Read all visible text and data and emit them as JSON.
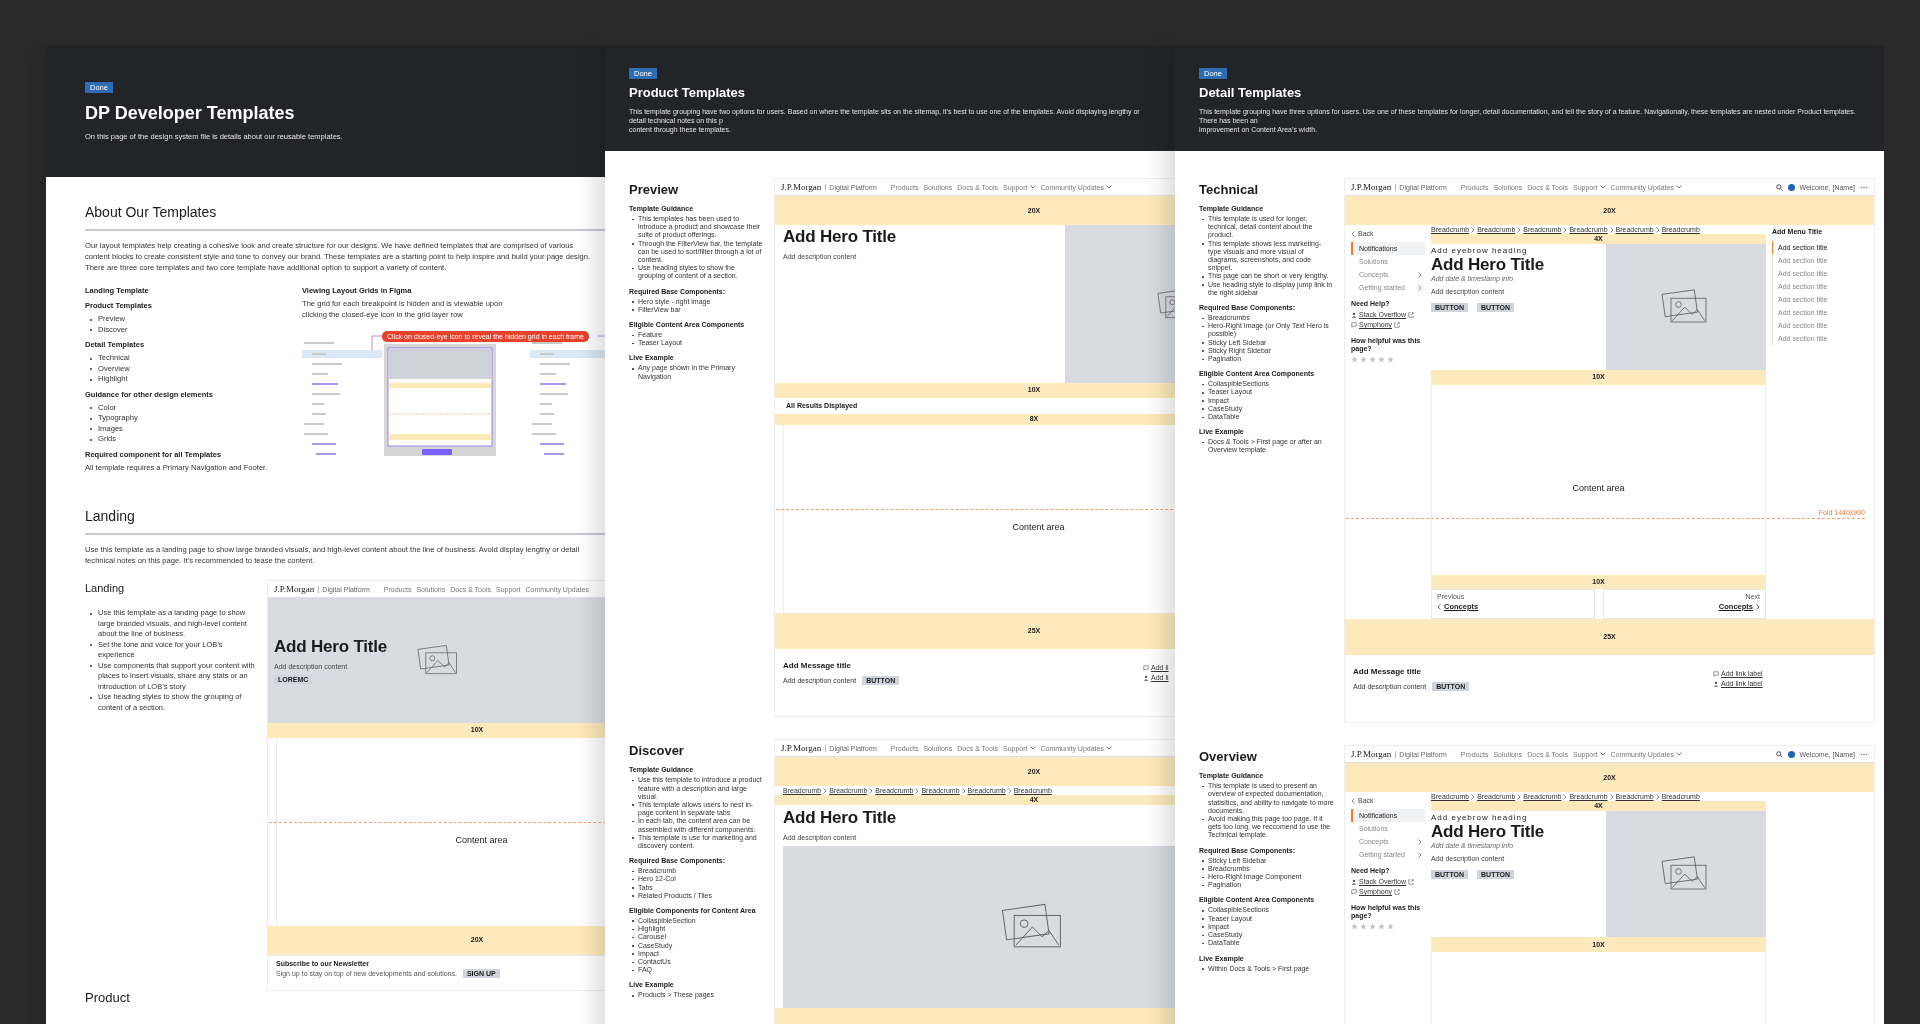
{
  "frames": [
    {
      "kind": "intro",
      "badge": "Done",
      "title": "DP Developer Templates",
      "description_lines": [
        "On this page of the design system file is details about our reusable templates."
      ],
      "about": {
        "heading": "About Our Templates",
        "paragraph": "Our layout templates help creating a cohesive look and create structure for our designs. We have defined templates that are comprised of various content blocks to create consistent style and tone to convey our brand. These templates are a starting point to help inspire and build your page design. There are three core templates and two core template have additional option to support a variety of content.",
        "groups": [
          {
            "heading": "Landing Template"
          },
          {
            "heading": "Product Templates",
            "items": [
              "Preview",
              "Discover"
            ]
          },
          {
            "heading": "Detail Templates",
            "items": [
              "Technical",
              "Overview",
              "Highlight"
            ]
          },
          {
            "heading": "Guidance for other design elements",
            "items": [
              "Color",
              "Typography",
              "Images",
              "Grids"
            ]
          },
          {
            "heading": "Required component for all Templates",
            "text": "All template requires a Primary Navigation and Footer."
          }
        ],
        "tip": {
          "heading": "Viewing Layout Grids in Figma",
          "text": "The grid for each breakpoint is hidden and is viewable upon clicking the closed-eye icon in the grid layer row",
          "callout": "Click on closed-eye icon to reveal the hidden grid in each frame"
        }
      },
      "section": {
        "heading": "Landing",
        "paragraph": "Use this template as a landing page to show large branded visuals, and high-level content about the line of business. Avoid display lengthy or detail technical notes on this page. It’s recommended to tease the content."
      },
      "templates": [
        {
          "name": "Landing",
          "guidance": [
            {
              "items": [
                "Use this template as a landing page to show large branded visuals, and high-level content about the line of business.",
                "Set the tone and voice for your LOB’s experience",
                "Use components that support your content with places to insert visuals, share any stats or an introduction of LOB’s story",
                "Use heading styles to show the grouping of content of a section."
              ]
            }
          ],
          "mockup": {
            "nav": {
              "logo": "J.P.Morgan",
              "product": "Digital Platform",
              "links": [
                {
                  "label": "Products",
                  "dropdown": false
                },
                {
                  "label": "Solutions",
                  "dropdown": false
                },
                {
                  "label": "Docs & Tools",
                  "dropdown": false
                },
                {
                  "label": "Support",
                  "dropdown": false
                },
                {
                  "label": "Community Updates",
                  "dropdown": false
                }
              ]
            },
            "blocks": [
              {
                "kind": "hero-banner",
                "title": "Add Hero Title",
                "description": "Add description content",
                "button": "LOREMC"
              },
              {
                "kind": "spacer",
                "label": "10X"
              },
              {
                "kind": "content",
                "label": "Content area",
                "fold": true
              },
              {
                "kind": "spacer",
                "label": "20X"
              },
              {
                "kind": "newsletter",
                "title": "Subscribe to our Newsletter",
                "text": "Sign up to stay on top of new developments and solutions.",
                "button": "SIGN UP"
              }
            ]
          }
        }
      ],
      "next_heading": "Product"
    },
    {
      "kind": "group",
      "badge": "Done",
      "title": "Product Templates",
      "description_lines": [
        "This template grouping have two options for users. Based on where the template sits on the sitemap, it’s best to use one of the templates. Avoid displaying lengthy or detail technical notes on this p",
        "content through these templates."
      ],
      "templates": [
        {
          "name": "Preview",
          "guidance": [
            {
              "heading": "Template Guidance",
              "items": [
                "This templates has been used to introduce a product and showcase their suite of product offerings.",
                "Through the FilterView bar, the template can be used to sort/filter through a lot of content.",
                "Use heading styles to show the grouping of content of a section."
              ]
            },
            {
              "heading": "Required Base Components:",
              "items": [
                "Hero style - right image",
                "FilterView bar"
              ]
            },
            {
              "heading": "Eligible Content Area Components",
              "items": [
                "Feature",
                "Teaser Layout"
              ]
            },
            {
              "heading": "Live Example",
              "items": [
                "Any page shown in the Primary Navigation"
              ]
            }
          ],
          "mockup": {
            "nav": {
              "logo": "J.P.Morgan",
              "product": "Digital Platform",
              "links": [
                {
                  "label": "Products",
                  "dropdown": false
                },
                {
                  "label": "Solutions",
                  "dropdown": false
                },
                {
                  "label": "Docs & Tools",
                  "dropdown": false
                },
                {
                  "label": "Support",
                  "dropdown": true
                },
                {
                  "label": "Community Updates",
                  "dropdown": true
                }
              ]
            },
            "blocks": [
              {
                "kind": "spacer",
                "label": "20X"
              },
              {
                "kind": "hero-split",
                "title": "Add Hero Title",
                "description": "Add description content"
              },
              {
                "kind": "spacer",
                "label": "10X"
              },
              {
                "kind": "results",
                "label": "All Results Displayed"
              },
              {
                "kind": "spacer",
                "label": "8X"
              },
              {
                "kind": "content",
                "label": "Content area",
                "fold": true
              },
              {
                "kind": "spacer",
                "label": "25X"
              },
              {
                "kind": "message",
                "title": "Add Message title",
                "description": "Add description content",
                "button": "BUTTON",
                "links": [
                  "Add li",
                  "Add li"
                ]
              }
            ]
          }
        },
        {
          "name": "Discover",
          "guidance": [
            {
              "heading": "Template Guidance",
              "items": [
                "Use this template to introduce a product feature with a description and large visual.",
                "This template allows users to nest in-page content in separate tabs",
                "In each tab, the content area can be assembled with different components.",
                "This template is use for marketing and discovery content."
              ]
            },
            {
              "heading": "Required Base Components:",
              "items": [
                "Breadcrumb",
                "Hero 12-Col",
                "Tabs",
                "Related Products / Tiles"
              ]
            },
            {
              "heading": "Eligible Components for Content Area",
              "items": [
                "CollaspibleSection",
                "Highlight",
                "Carousel",
                "CaseStudy",
                "Impact",
                "ContactUs",
                "FAQ"
              ]
            },
            {
              "heading": "Live Example",
              "items": [
                "Products > These pages"
              ]
            }
          ],
          "mockup": {
            "nav": {
              "logo": "J.P.Morgan",
              "product": "Digital Platform",
              "links": [
                {
                  "label": "Products",
                  "dropdown": false
                },
                {
                  "label": "Solutions",
                  "dropdown": false
                },
                {
                  "label": "Docs & Tools",
                  "dropdown": false
                },
                {
                  "label": "Support",
                  "dropdown": true
                },
                {
                  "label": "Community Updates",
                  "dropdown": true
                }
              ]
            },
            "blocks": [
              {
                "kind": "spacer",
                "label": "20X"
              },
              {
                "kind": "breadcrumbs",
                "items": [
                  "Breadcrumb",
                  "Breadcrumb",
                  "Breadcrumb",
                  "Breadcrumb",
                  "Breadcrumb",
                  "Breadcrumb"
                ]
              },
              {
                "kind": "spacer",
                "label": "4X"
              },
              {
                "kind": "hero-wide",
                "title": "Add Hero Title",
                "description": "Add description content"
              },
              {
                "kind": "spacer"
              }
            ]
          }
        }
      ]
    },
    {
      "kind": "group",
      "badge": "Done",
      "title": "Detail Templates",
      "description_lines": [
        "This template grouping have three options for users. Use one of these templates for longer, detail documentation, and tell the story of a feature. Navigationally, these templates are nested under Product templates. There has been an",
        "improvement on Content Area’s width."
      ],
      "templates": [
        {
          "name": "Technical",
          "guidance": [
            {
              "heading": "Template Guidance",
              "items": [
                "This template is used for longer, technical, detail content about the product.",
                "This template shows less marketing-type visuals and more visual of diagrams, screenshots, and code snippet.",
                "This page can be short or very lengthy.",
                "Use heading style to display jump link in the right sidebar"
              ]
            },
            {
              "heading": "Required Base Components:",
              "items": [
                "Breadcrumbs",
                "Hero-Right Image (or Only Text Hero is possible)",
                "Sticky Left Sidebar",
                "Sticky Right Sidebar",
                "Pagination"
              ]
            },
            {
              "heading": "Eligible Content Area Components",
              "items": [
                "CollaspibleSections",
                "Teaser Layout",
                "Impact",
                "CaseStudy",
                "DataTable"
              ]
            },
            {
              "heading": "Live Example",
              "items": [
                "Docs & Tools > First page or after an Overview template"
              ]
            }
          ],
          "mockup": {
            "nav": {
              "logo": "J.P.Morgan",
              "product": "Digital Platform",
              "links": [
                {
                  "label": "Products",
                  "dropdown": false
                },
                {
                  "label": "Solutions",
                  "dropdown": false
                },
                {
                  "label": "Docs & Tools",
                  "dropdown": false
                },
                {
                  "label": "Support",
                  "dropdown": true
                },
                {
                  "label": "Community Updates",
                  "dropdown": true
                }
              ],
              "welcome": "Welcome, [Name]"
            },
            "blocks": [
              {
                "kind": "spacer",
                "label": "20X"
              },
              {
                "kind": "detail",
                "sidebar": {
                  "back": "Back",
                  "items": [
                    {
                      "label": "Notifications",
                      "selected": true,
                      "chevron": false
                    },
                    {
                      "label": "Solutions",
                      "selected": false,
                      "chevron": false
                    },
                    {
                      "label": "Concepts",
                      "selected": false,
                      "chevron": true
                    },
                    {
                      "label": "Getting started",
                      "selected": false,
                      "chevron": true
                    }
                  ],
                  "help_title": "Need Help?",
                  "links": [
                    "Stack Overflow",
                    "Symphony"
                  ],
                  "rating_question": "How helpful was this page?",
                  "stars": 0
                },
                "main": [
                  {
                    "kind": "breadcrumbs",
                    "items": [
                      "Breadcrumb",
                      "Breadcrumb",
                      "Breadcrumb",
                      "Breadcrumb",
                      "Breadcrumb",
                      "Breadcrumb"
                    ]
                  },
                  {
                    "kind": "spacer",
                    "label": "4X"
                  },
                  {
                    "kind": "hero-detail",
                    "eyebrow": "Add eyebrow heading",
                    "title": "Add Hero Title",
                    "date": "Add date & timestamp info",
                    "description": "Add description content",
                    "buttons": [
                      "BUTTON",
                      "BUTTON"
                    ]
                  },
                  {
                    "kind": "spacer",
                    "label": "10X"
                  },
                  {
                    "kind": "content",
                    "label": "Content area",
                    "fold": true,
                    "fold_label": "Fold 1440x900"
                  },
                  {
                    "kind": "spacer",
                    "label": "10X"
                  },
                  {
                    "kind": "pagination",
                    "previous": {
                      "caption": "Previous",
                      "label": "Concepts"
                    },
                    "next": {
                      "caption": "Next",
                      "label": "Concepts"
                    }
                  }
                ],
                "menu": {
                  "title": "Add Menu Title",
                  "items": [
                    {
                      "label": "Add section title",
                      "selected": true
                    },
                    {
                      "label": "Add section title",
                      "selected": false
                    },
                    {
                      "label": "Add section title",
                      "selected": false
                    },
                    {
                      "label": "Add section title",
                      "selected": false
                    },
                    {
                      "label": "Add section title",
                      "selected": false
                    },
                    {
                      "label": "Add section title",
                      "selected": false
                    },
                    {
                      "label": "Add section title",
                      "selected": false
                    },
                    {
                      "label": "Add section title",
                      "selected": false
                    }
                  ]
                }
              },
              {
                "kind": "spacer",
                "label": "25X"
              },
              {
                "kind": "message",
                "title": "Add Message title",
                "description": "Add description content",
                "button": "BUTTON",
                "links": [
                  "Add link label",
                  "Add link label"
                ]
              }
            ]
          }
        },
        {
          "name": "Overview",
          "guidance": [
            {
              "heading": "Template Guidance",
              "items": [
                "This template is used to present an overview of expected documentation, statisitics, and ability to navigate to more documents.",
                "Avoid making this page too page. If it gets too long, we reccomend to use the Technical template."
              ]
            },
            {
              "heading": "Required Base Components:",
              "items": [
                "Sticky Left Sidebar",
                "Breadcrumbs",
                "Hero-Right Image Component",
                "Pagination"
              ]
            },
            {
              "heading": "Eligible Content Area Components",
              "items": [
                "CollaspibleSections",
                "Teaser Layout",
                "Impact",
                "CaseStudy",
                "DataTable"
              ]
            },
            {
              "heading": "Live Example",
              "items": [
                "Within Docs & Tools > First page"
              ]
            }
          ],
          "mockup": {
            "nav": {
              "logo": "J.P.Morgan",
              "product": "Digital Platform",
              "links": [
                {
                  "label": "Products",
                  "dropdown": false
                },
                {
                  "label": "Solutions",
                  "dropdown": false
                },
                {
                  "label": "Docs & Tools",
                  "dropdown": false
                },
                {
                  "label": "Support",
                  "dropdown": true
                },
                {
                  "label": "Community Updates",
                  "dropdown": true
                }
              ],
              "welcome": "Welcome, [Name]"
            },
            "blocks": [
              {
                "kind": "spacer",
                "label": "20X"
              },
              {
                "kind": "detail",
                "sidebar": {
                  "back": "Back",
                  "items": [
                    {
                      "label": "Notifications",
                      "selected": true,
                      "chevron": false
                    },
                    {
                      "label": "Solutions",
                      "selected": false,
                      "chevron": false
                    },
                    {
                      "label": "Concepts",
                      "selected": false,
                      "chevron": true
                    },
                    {
                      "label": "Getting started",
                      "selected": false,
                      "chevron": true
                    }
                  ],
                  "help_title": "Need Help?",
                  "links": [
                    "Stack Overflow",
                    "Symphony"
                  ],
                  "rating_question": "How helpful was this page?",
                  "stars": 0
                },
                "main": [
                  {
                    "kind": "breadcrumbs",
                    "items": [
                      "Breadcrumb",
                      "Breadcrumb",
                      "Breadcrumb",
                      "Breadcrumb",
                      "Breadcrumb",
                      "Breadcrumb"
                    ]
                  },
                  {
                    "kind": "spacer",
                    "label": "4X"
                  },
                  {
                    "kind": "hero-detail",
                    "eyebrow": "Add eyebrow heading",
                    "title": "Add Hero Title",
                    "date": "Add date & timestamp info",
                    "description": "Add description content",
                    "buttons": [
                      "BUTTON",
                      "BUTTON"
                    ]
                  },
                  {
                    "kind": "spacer",
                    "label": "10X"
                  },
                  {
                    "kind": "content"
                  }
                ]
              }
            ]
          }
        }
      ]
    }
  ]
}
